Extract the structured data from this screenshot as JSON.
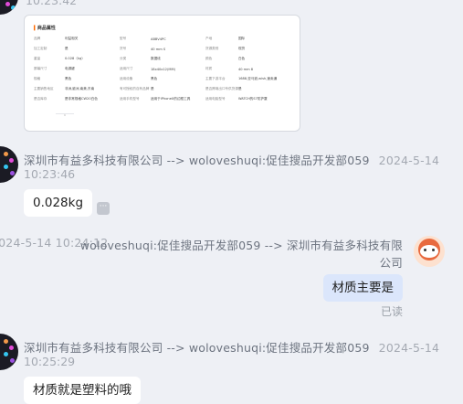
{
  "chat": {
    "top_partial_time": "10:23:42",
    "image_message": {
      "title": "商品属性",
      "rows": [
        [
          "品牌",
          "利益相关",
          "型号",
          "ABBV4PC",
          "产地",
          "国际"
        ],
        [
          "加工定制",
          "是",
          "货号",
          "40 mm S",
          "货源类别",
          "现货"
        ],
        [
          "重量",
          "0.028（kg）",
          "分类",
          "数据线",
          "颜色",
          "白色"
        ],
        [
          "屏幕尺寸",
          "电源键",
          "适用尺寸",
          "18x40x12(MM)",
          "材质",
          "40 mm 8"
        ],
        [
          "规格",
          "黑色",
          "适用设备",
          "黑色",
          "主要下游平台",
          "1688,亚马逊,wish,速卖通"
        ],
        [
          "主要销售地区",
          "非洲,欧洲,南美,东南",
          "有可授权的自有品牌",
          "是",
          "是否跨境出口专供货源",
          "是"
        ],
        [
          "是否库存",
          "是非常规格CW20白色",
          "适用手机型号",
          "适用于iPhoneX的边框工具",
          "适用电脑型号",
          "WATCH的S7防护罩"
        ]
      ]
    },
    "msg1": {
      "sender": "深圳市有益多科技有限公司 --> woloveshuqi:促佳搜品开发部059",
      "date": "2024-5-14",
      "time": "10:23:46",
      "text": "0.028kg",
      "more_label": "···"
    },
    "msg2": {
      "date": "2024-5-14 10:24:12",
      "sender_line1": "woloveshuqi:促佳搜品开发部059 --> 深圳市有益多科技有限",
      "sender_line2": "公司",
      "text": "材质主要是",
      "status": "已读"
    },
    "msg3": {
      "sender": "深圳市有益多科技有限公司 --> woloveshuqi:促佳搜品开发部059",
      "date": "2024-5-14",
      "time": "10:25:29",
      "text": "材质就是塑料的哦"
    }
  }
}
